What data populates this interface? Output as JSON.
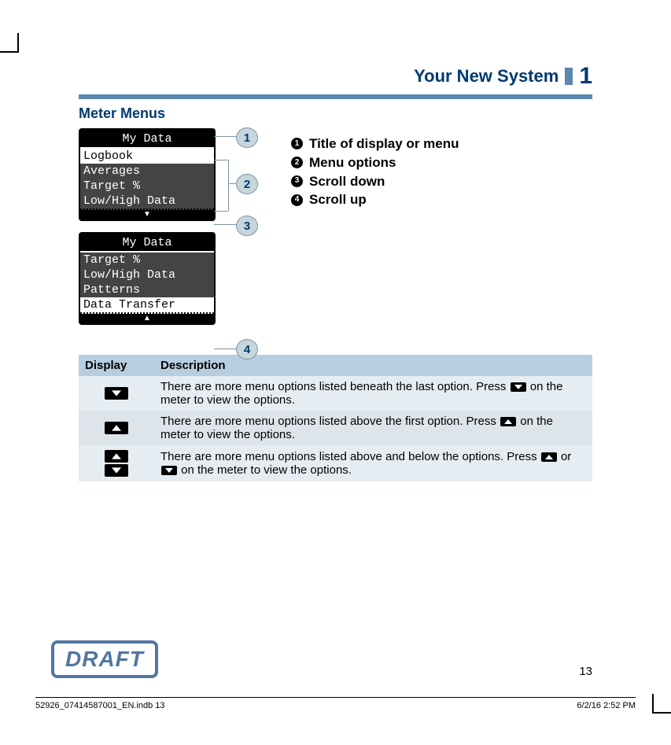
{
  "header": {
    "title": "Your New System",
    "chapter": "1"
  },
  "section_title": "Meter Menus",
  "lcd1": {
    "title": "My Data",
    "rows": [
      "Logbook",
      "Averages",
      "Target %",
      "Low/High Data"
    ]
  },
  "lcd2": {
    "title": "My Data",
    "rows": [
      "Target %",
      "Low/High Data",
      "Patterns",
      "Data Transfer"
    ]
  },
  "callouts": {
    "c1": "1",
    "c2": "2",
    "c3": "3",
    "c4": "4"
  },
  "legend": [
    {
      "n": "1",
      "text": "Title of display or menu"
    },
    {
      "n": "2",
      "text": "Menu options"
    },
    {
      "n": "3",
      "text": "Scroll down"
    },
    {
      "n": "4",
      "text": "Scroll up"
    }
  ],
  "table": {
    "h1": "Display",
    "h2": "Description",
    "rows": [
      {
        "pre": "There are more menu options listed beneath the last option. Press ",
        "post": " on the meter to view the options."
      },
      {
        "pre": "There are more menu options listed above the first option. Press ",
        "post": " on the meter to view the options."
      },
      {
        "pre": "There are more menu options listed above and below the options. Press ",
        "mid": " or ",
        "post": " on the meter to view the options."
      }
    ]
  },
  "draft": "DRAFT",
  "page_number": "13",
  "footer": {
    "left": "52926_07414587001_EN.indb   13",
    "right": "6/2/16   2:52 PM"
  }
}
